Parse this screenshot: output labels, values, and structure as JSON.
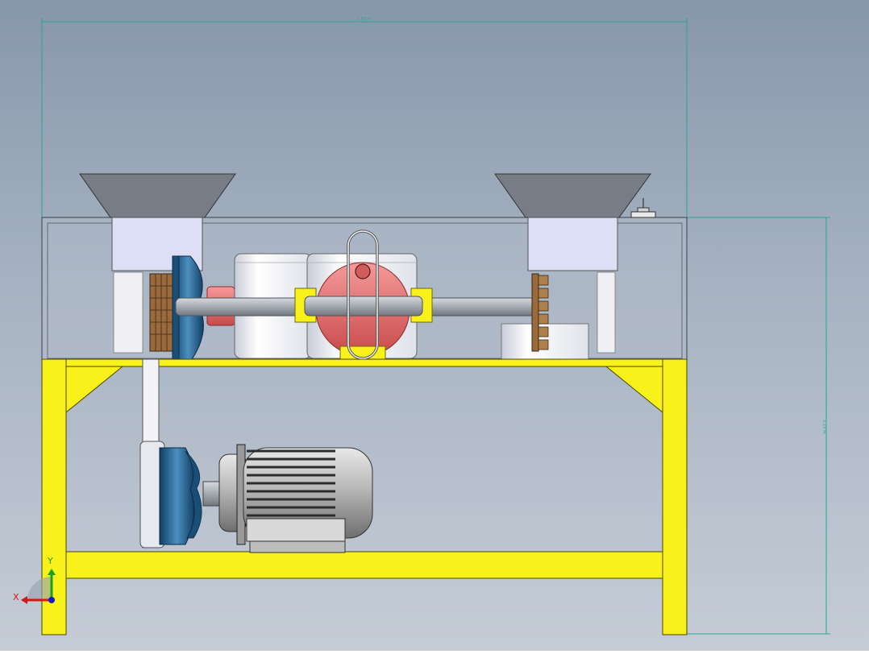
{
  "viewport": {
    "background_top": "#8797ab",
    "background_bottom": "#c5ccd6"
  },
  "dimensions": {
    "width_text": "1.53 m",
    "height_text": "1.19 m",
    "line_color": "#2aa39a"
  },
  "triad": {
    "x_label": "X",
    "y_label": "Y",
    "x_color": "#d01818",
    "y_color": "#18a018",
    "z_color": "#1818c8"
  },
  "colors": {
    "frame_yellow": "#f8f21a",
    "hopper_gray": "#787c86",
    "chute_lavender": "#dcdff5",
    "pulley_blue": "#2f6d9a",
    "cam_red": "#f07070",
    "motor_gray": "#a9a9a9",
    "brush_brown": "#9b6a3c"
  }
}
